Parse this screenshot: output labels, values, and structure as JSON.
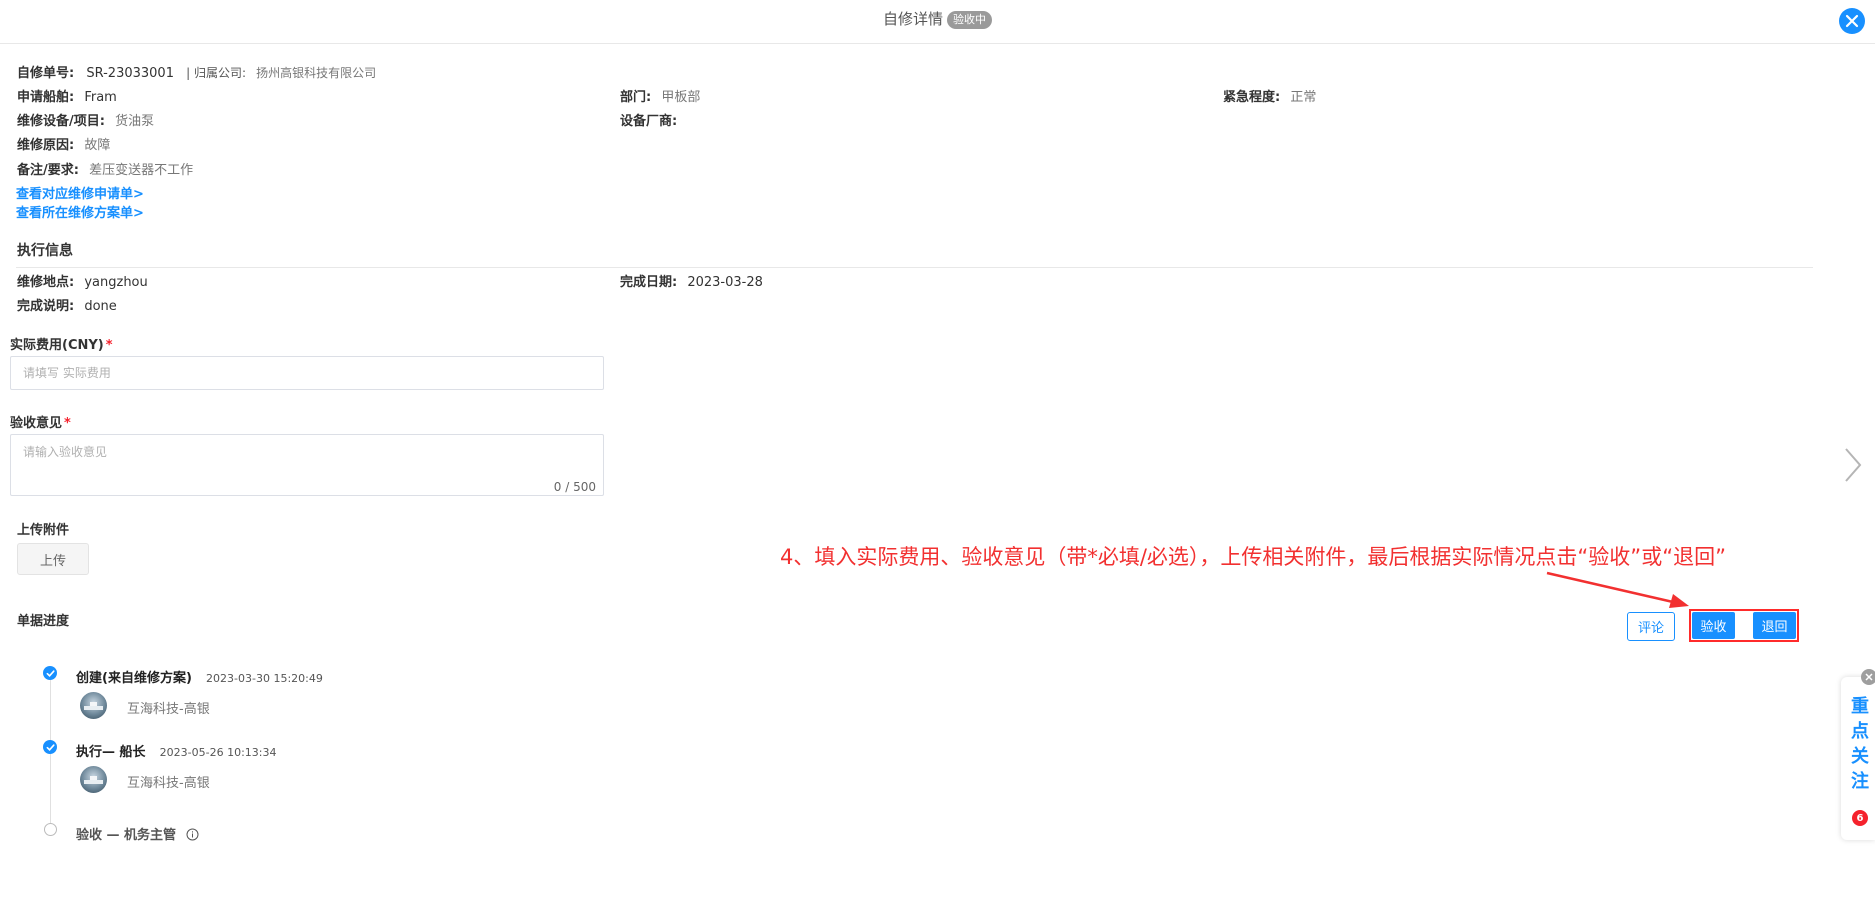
{
  "header": {
    "title": "自修详情",
    "status_badge": "验收中"
  },
  "info": {
    "order_no_label": "自修单号:",
    "order_no": "SR-23033001",
    "company_label": "| 归属公司:",
    "company": "扬州高银科技有限公司",
    "ship_label": "申请船舶:",
    "ship": "Fram",
    "dept_label": "部门:",
    "dept": "甲板部",
    "urgency_label": "紧急程度:",
    "urgency": "正常",
    "equipment_label": "维修设备/项目:",
    "equipment": "货油泵",
    "vendor_label": "设备厂商:",
    "vendor": "",
    "reason_label": "维修原因:",
    "reason": "故障",
    "remark_label": "备注/要求:",
    "remark": "差压变送器不工作",
    "link_request": "查看对应维修申请单>",
    "link_plan": "查看所在维修方案单>"
  },
  "execution": {
    "section_title": "执行信息",
    "location_label": "维修地点:",
    "location": "yangzhou",
    "date_label": "完成日期:",
    "date": "2023-03-28",
    "desc_label": "完成说明:",
    "desc": "done"
  },
  "form": {
    "cost_label": "实际费用(CNY)",
    "cost_placeholder": "请填写 实际费用",
    "opinion_label": "验收意见",
    "opinion_placeholder": "请输入验收意见",
    "opinion_counter": "0 / 500",
    "required_mark": "*",
    "attachment_label": "上传附件",
    "upload_button": "上传"
  },
  "annotation": "4、填入实际费用、验收意见（带*必填/必选），上传相关附件，最后根据实际情况点击“验收”或“退回”",
  "progress": {
    "section_title": "单据进度",
    "comment_button": "评论",
    "accept_button": "验收",
    "return_button": "退回",
    "steps": [
      {
        "title": "创建(来自维修方案)",
        "time": "2023-03-30 15:20:49",
        "user": "互海科技-高银",
        "status": "done"
      },
      {
        "title": "执行— 船长",
        "time": "2023-05-26 10:13:34",
        "user": "互海科技-高银",
        "status": "done"
      },
      {
        "title": "验收 — 机务主管",
        "time": "",
        "user": "",
        "status": "pending"
      }
    ]
  },
  "side_panel": {
    "label": "重点关注",
    "badge": "6"
  },
  "colors": {
    "accent": "#1890ff",
    "annotation": "#f23030",
    "required": "#f5222d"
  }
}
